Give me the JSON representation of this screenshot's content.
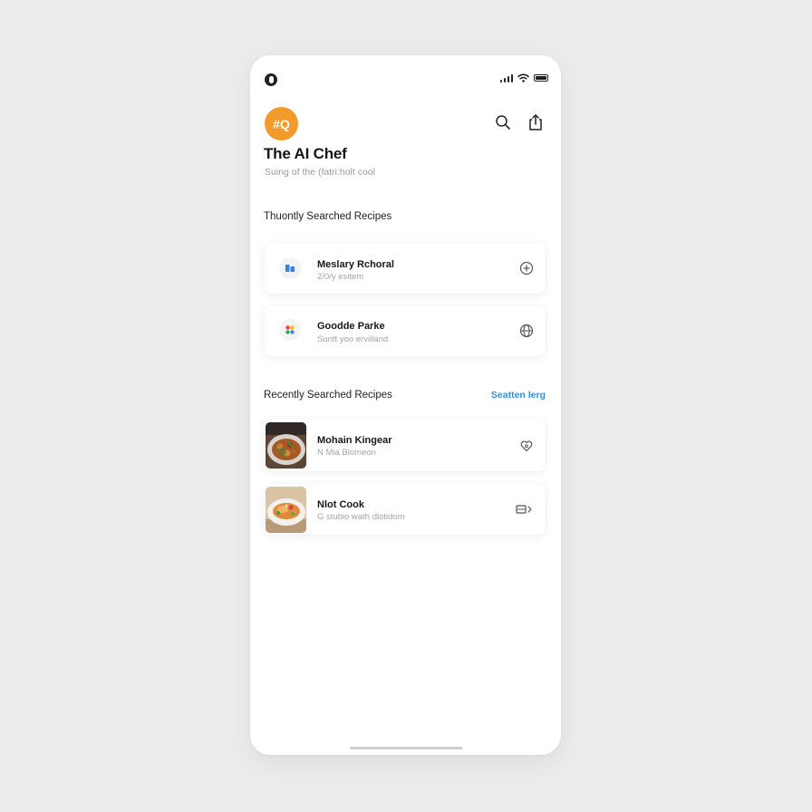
{
  "status_bar": {
    "left_icon": "camera-icon",
    "right_icons": [
      "cellular-signal-icon",
      "wifi-icon",
      "battery-icon"
    ]
  },
  "header": {
    "logo_text": "#Q",
    "logo_color": "#f39a2c",
    "actions": [
      "search-icon",
      "share-icon"
    ],
    "title": "The AI Chef",
    "subtitle": "Suing of the (fatri:holt cool"
  },
  "frequent": {
    "title": "Thuontly Searched Recipes",
    "items": [
      {
        "name": "Meslary Rchoral",
        "meta": "2/0/y esitem",
        "icon": "blocks-icon",
        "action_icon": "add-circle-icon"
      },
      {
        "name": "Goodde Parke",
        "meta": "Suntt yoo ervilland",
        "icon": "palette-icon",
        "action_icon": "globe-icon"
      }
    ]
  },
  "recent": {
    "title": "Recently Searched Recipes",
    "link": "Seatten lerg",
    "link_color": "#3a8fd6",
    "items": [
      {
        "name": "Mohain Kingear",
        "meta": "N Mia Blomeon",
        "image": "stir-fry-dish-photo",
        "action_icon": "heart-icon"
      },
      {
        "name": "Nlot Cook",
        "meta": "G stubio wath dlotidom",
        "image": "plated-dish-photo",
        "action_icon": "open-recipe-icon"
      }
    ]
  }
}
